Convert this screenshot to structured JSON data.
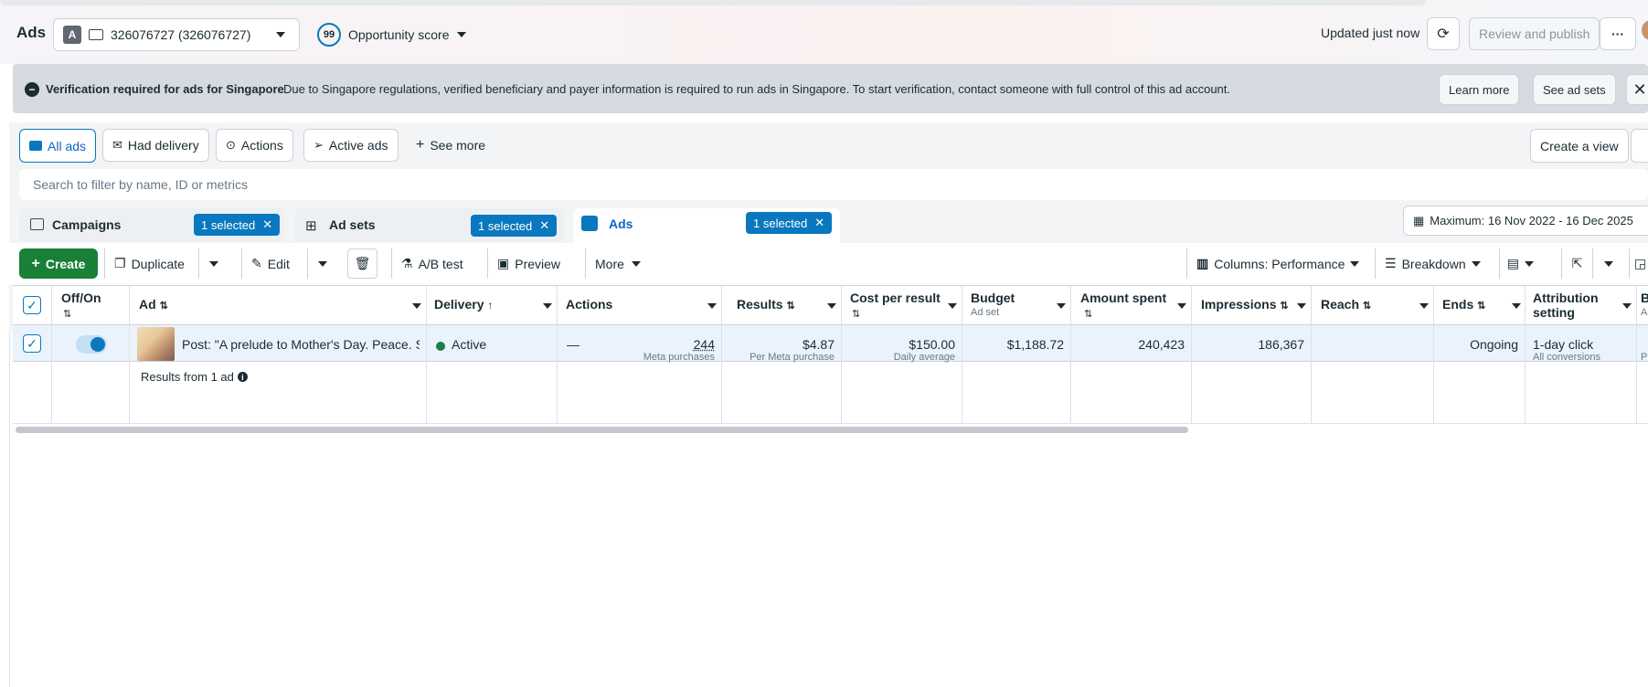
{
  "header": {
    "title": "Ads",
    "account_badge": "A",
    "account_id": "326076727 (326076727)",
    "opportunity_value": "99",
    "opportunity_label": "Opportunity score",
    "updated": "Updated just now",
    "review_publish": "Review and publish",
    "more": "···"
  },
  "banner": {
    "title": "Verification required for ads for Singapore",
    "message": "Due to Singapore regulations, verified beneficiary and payer information is required to run ads in Singapore. To start verification, contact someone with full control of this ad account.",
    "learn_more": "Learn more",
    "see_ad_sets": "See ad sets"
  },
  "views": {
    "tabs": [
      {
        "label": "All ads",
        "icon": "folder-icon",
        "active": true
      },
      {
        "label": "Had delivery",
        "icon": "envelope-icon",
        "active": false
      },
      {
        "label": "Actions",
        "icon": "arrow-up-circle-icon",
        "active": false
      },
      {
        "label": "Active ads",
        "icon": "paper-plane-icon",
        "active": false
      }
    ],
    "see_more": "See more",
    "create_view": "Create a view"
  },
  "search": {
    "placeholder": "Search to filter by name, ID or metrics"
  },
  "levels": {
    "campaigns": {
      "label": "Campaigns",
      "selected": "1 selected"
    },
    "ad_sets": {
      "label": "Ad sets",
      "selected": "1 selected"
    },
    "ads": {
      "label": "Ads",
      "selected": "1 selected"
    },
    "date_range": "Maximum: 16 Nov 2022 - 16 Dec 2025"
  },
  "toolbar": {
    "create": "Create",
    "duplicate": "Duplicate",
    "edit": "Edit",
    "ab_test": "A/B test",
    "preview": "Preview",
    "more": "More",
    "columns": "Columns: Performance",
    "breakdown": "Breakdown"
  },
  "table": {
    "headers": {
      "offon": "Off/On",
      "ad": "Ad",
      "delivery": "Delivery",
      "actions": "Actions",
      "results": "Results",
      "cost_per_result": "Cost per result",
      "budget": "Budget",
      "budget_sub": "Ad set",
      "amount_spent": "Amount spent",
      "impressions": "Impressions",
      "reach": "Reach",
      "ends": "Ends",
      "attribution": "Attribution setting",
      "bid": "Bic",
      "bid_sub": "Ad"
    },
    "row": {
      "ad_name": "Post: \"A prelude to Mother's Day. Peace. Sh...",
      "delivery": "Active",
      "actions": "—",
      "results": "244",
      "results_sub": "Meta purchases",
      "cost": "$4.87",
      "cost_sub": "Per Meta purchase",
      "budget": "$150.00",
      "budget_sub": "Daily average",
      "spent": "$1,188.72",
      "impressions": "240,423",
      "reach": "186,367",
      "ends": "Ongoing",
      "attribution": "1-day click",
      "attribution_sub": "All conversions",
      "bid_sub": "Pur"
    },
    "summary": "Results from 1 ad"
  },
  "colors": {
    "accent": "#0a78be",
    "create": "#1a7f37",
    "active_dot": "#1a7f4b"
  }
}
